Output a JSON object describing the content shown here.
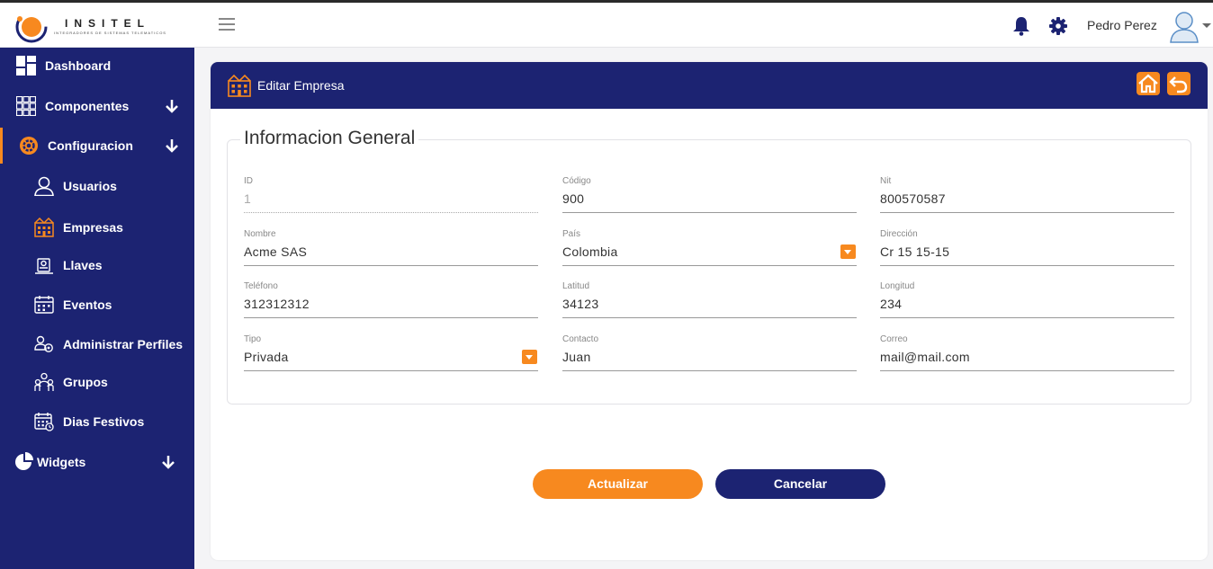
{
  "brand": {
    "name": "INSITEL",
    "tagline": "INTEGRADORES DE SISTEMAS TELEMATICOS"
  },
  "topbar": {
    "user_name": "Pedro Perez"
  },
  "sidebar": {
    "items": [
      {
        "label": "Dashboard",
        "icon": "dashboard-icon"
      },
      {
        "label": "Componentes",
        "icon": "grid-icon"
      },
      {
        "label": "Configuracion",
        "icon": "cog-icon"
      },
      {
        "label": "Usuarios",
        "icon": "user-icon"
      },
      {
        "label": "Empresas",
        "icon": "building-icon"
      },
      {
        "label": "Llaves",
        "icon": "key-icon"
      },
      {
        "label": "Eventos",
        "icon": "calendar-icon"
      },
      {
        "label": "Administrar Perfiles",
        "icon": "profiles-icon"
      },
      {
        "label": "Grupos",
        "icon": "group-icon"
      },
      {
        "label": "Dias Festivos",
        "icon": "holiday-calendar-icon"
      },
      {
        "label": "Widgets",
        "icon": "pie-chart-icon"
      }
    ]
  },
  "card": {
    "title": "Editar Empresa"
  },
  "form": {
    "legend": "Informacion General",
    "fields": {
      "id": {
        "label": "ID",
        "value": "1"
      },
      "codigo": {
        "label": "Código",
        "value": "900"
      },
      "nit": {
        "label": "Nit",
        "value": "800570587"
      },
      "nombre": {
        "label": "Nombre",
        "value": "Acme SAS"
      },
      "pais": {
        "label": "País",
        "value": "Colombia"
      },
      "direccion": {
        "label": "Dirección",
        "value": "Cr 15 15-15"
      },
      "telefono": {
        "label": "Teléfono",
        "value": "312312312"
      },
      "latitud": {
        "label": "Latitud",
        "value": "34123"
      },
      "longitud": {
        "label": "Longitud",
        "value": "234"
      },
      "tipo": {
        "label": "Tipo",
        "value": "Privada"
      },
      "contacto": {
        "label": "Contacto",
        "value": "Juan"
      },
      "correo": {
        "label": "Correo",
        "value": "mail@mail.com"
      }
    }
  },
  "actions": {
    "update_label": "Actualizar",
    "cancel_label": "Cancelar"
  },
  "colors": {
    "navy": "#1c2372",
    "accent": "#f7891f"
  }
}
